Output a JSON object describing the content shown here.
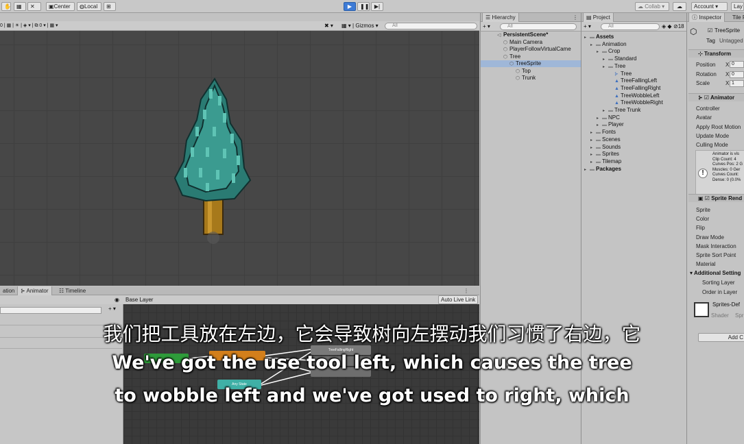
{
  "toolbar": {
    "center_label": "Center",
    "local_label": "Local",
    "collab_label": "Collab",
    "account_label": "Account",
    "layers_label": "Lay"
  },
  "scene": {
    "gizmos_label": "Gizmos",
    "search_placeholder": "All",
    "layer_count": "0"
  },
  "bottom_tabs": {
    "animation_label": "ation",
    "animator_label": "Animator",
    "timeline_label": "Timeline",
    "base_layer": "Base Layer",
    "auto_live_link": "Auto Live Link",
    "nodes": {
      "top_right": "TreeFallingRight",
      "any_state": "Any State"
    }
  },
  "hierarchy": {
    "title": "Hierarchy",
    "search_placeholder": "All",
    "items": [
      {
        "label": "PersistentScene*",
        "depth": 0
      },
      {
        "label": "Main Camera",
        "depth": 1
      },
      {
        "label": "PlayerFollowVirtualCame",
        "depth": 1
      },
      {
        "label": "Tree",
        "depth": 1
      },
      {
        "label": "TreeSprite",
        "depth": 2,
        "selected": true
      },
      {
        "label": "Top",
        "depth": 3
      },
      {
        "label": "Trunk",
        "depth": 3
      }
    ]
  },
  "project": {
    "title": "Project",
    "search_placeholder": "All",
    "hidden_count": "18",
    "items": [
      {
        "label": "Assets",
        "depth": 0,
        "bold": true
      },
      {
        "label": "Animation",
        "depth": 1
      },
      {
        "label": "Crop",
        "depth": 2
      },
      {
        "label": "Standard",
        "depth": 3
      },
      {
        "label": "Tree",
        "depth": 3
      },
      {
        "label": "Tree",
        "depth": 4,
        "type": "controller"
      },
      {
        "label": "TreeFallingLeft",
        "depth": 4,
        "type": "anim"
      },
      {
        "label": "TreeFallingRight",
        "depth": 4,
        "type": "anim"
      },
      {
        "label": "TreeWobbleLeft",
        "depth": 4,
        "type": "anim"
      },
      {
        "label": "TreeWobbleRight",
        "depth": 4,
        "type": "anim"
      },
      {
        "label": "Tree Trunk",
        "depth": 3
      },
      {
        "label": "NPC",
        "depth": 2
      },
      {
        "label": "Player",
        "depth": 2
      },
      {
        "label": "Fonts",
        "depth": 1
      },
      {
        "label": "Scenes",
        "depth": 1
      },
      {
        "label": "Sounds",
        "depth": 1
      },
      {
        "label": "Sprites",
        "depth": 1
      },
      {
        "label": "Tilemap",
        "depth": 1
      },
      {
        "label": "Packages",
        "depth": 0,
        "bold": true
      }
    ]
  },
  "inspector": {
    "tab_inspector": "Inspector",
    "tab_tile": "Tile P",
    "object_name": "TreeSprite",
    "tag_label": "Tag",
    "tag_value": "Untagged",
    "transform": {
      "header": "Transform",
      "position_label": "Position",
      "rotation_label": "Rotation",
      "scale_label": "Scale",
      "x_label": "X",
      "position_x": "0",
      "rotation_x": "0",
      "scale_x": "1"
    },
    "animator": {
      "header": "Animator",
      "fields": [
        "Controller",
        "Avatar",
        "Apply Root Motion",
        "Update Mode",
        "Culling Mode"
      ],
      "info_lines": [
        "Animator is vis",
        "Clip Count: 4",
        "Curves Pos: 2 G",
        "Muscles: 0 Ger",
        "Curves Count:",
        "Dense: 0 (0.0%"
      ]
    },
    "sprite_renderer": {
      "header": "Sprite Rend",
      "fields": [
        "Sprite",
        "Color",
        "Flip",
        "Draw Mode",
        "Mask Interaction",
        "Sprite Sort Point",
        "Material"
      ],
      "additional_header": "Additional Setting",
      "additional_fields": [
        "Sorting Layer",
        "Order in Layer"
      ]
    },
    "material_name": "Sprites-Def",
    "shader_label": "Shader",
    "shader_value": "Spr",
    "add_component": "Add C"
  },
  "subtitles": {
    "chinese": "我们把工具放在左边，它会导致树向左摆动我们习惯了右边，它",
    "english_line1": "We've got the use tool left, which causes the tree",
    "english_line2": "to wobble left and we've got used to right, which"
  }
}
